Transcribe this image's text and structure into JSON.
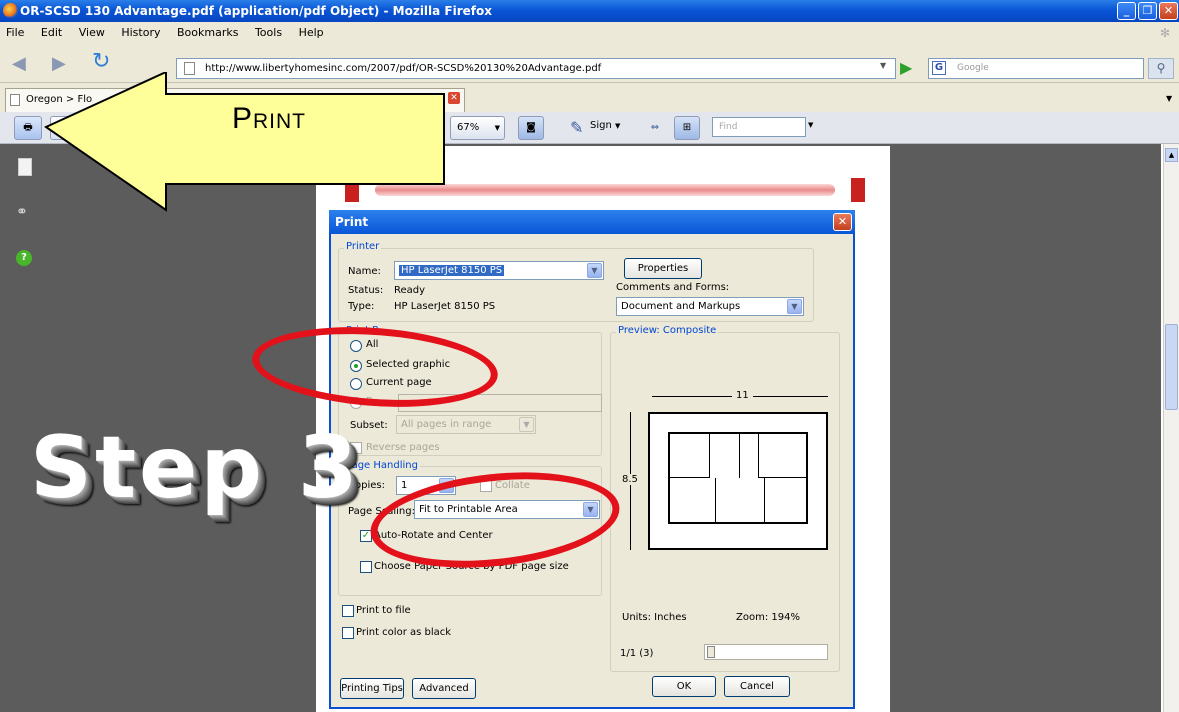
{
  "window": {
    "title": "OR-SCSD 130 Advantage.pdf (application/pdf Object) - Mozilla Firefox"
  },
  "menu": [
    "File",
    "Edit",
    "View",
    "History",
    "Bookmarks",
    "Tools",
    "Help"
  ],
  "nav": {
    "url": "http://www.libertyhomesinc.com/2007/pdf/OR-SCSD%20130%20Advantage.pdf",
    "search_placeholder": "Google"
  },
  "tab": {
    "label": "Oregon > Flo"
  },
  "pdf_toolbar": {
    "zoom": "67%",
    "sign": "Sign",
    "find_placeholder": "Find"
  },
  "overlay": {
    "print_label": "Print",
    "step_label": "Step 3"
  },
  "dialog": {
    "title": "Print",
    "printer_group": "Printer",
    "name_label": "Name:",
    "name_value": "HP LaserJet 8150 PS",
    "properties": "Properties",
    "status_label": "Status:",
    "status_value": "Ready",
    "type_label": "Type:",
    "type_value": "HP LaserJet 8150 PS",
    "comments_label": "Comments and Forms:",
    "comments_value": "Document and Markups",
    "range_group": "Print R",
    "all": "All",
    "selected": "Selected graphic",
    "current": "Current page",
    "pages_label": "P",
    "subset_label": "Subset:",
    "subset_value": "All pages in range",
    "reverse": "Reverse pages",
    "handling_group": "Page Handling",
    "copies_label": "Copies:",
    "copies_value": "1",
    "collate": "Collate",
    "scaling_label": "Page Scaling:",
    "scaling_value": "Fit to Printable Area",
    "autorotate": "Auto-Rotate and Center",
    "paper_source": "Choose Paper Source by PDF page size",
    "print_to_file": "Print to file",
    "print_black": "Print color as black",
    "preview_group": "Preview: Composite",
    "width_label": "11",
    "height_label": "8.5",
    "units": "Units: Inches",
    "zoom": "Zoom: 194%",
    "page_count": "1/1 (3)",
    "tips": "Printing Tips",
    "advanced": "Advanced",
    "ok": "OK",
    "cancel": "Cancel"
  },
  "colors": {
    "accent": "#0a55d6",
    "highlight": "#e3111a",
    "arrow_fill": "#ffff99"
  }
}
